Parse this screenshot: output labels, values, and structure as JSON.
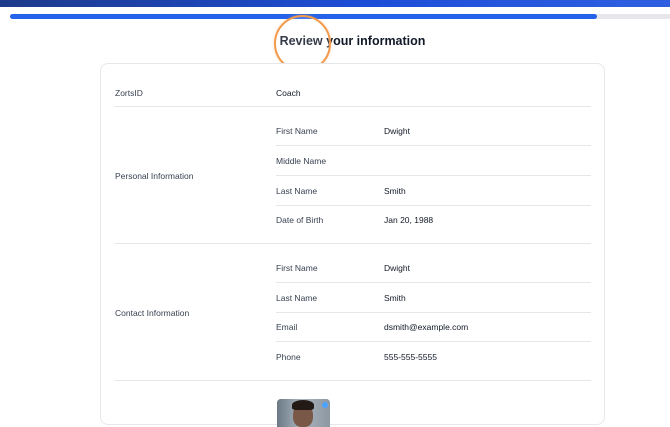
{
  "progress": {
    "fraction": 0.89
  },
  "title": "Review your information",
  "zortsid": {
    "label": "ZortsID",
    "value": "Coach"
  },
  "personal": {
    "label": "Personal Information",
    "fields": [
      {
        "label": "First Name",
        "value": "Dwight"
      },
      {
        "label": "Middle Name",
        "value": ""
      },
      {
        "label": "Last Name",
        "value": "Smith"
      },
      {
        "label": "Date of Birth",
        "value": "Jan 20, 1988"
      }
    ]
  },
  "contact": {
    "label": "Contact Information",
    "fields": [
      {
        "label": "First Name",
        "value": "Dwight"
      },
      {
        "label": "Last Name",
        "value": "Smith"
      },
      {
        "label": "Email",
        "value": "dsmith@example.com"
      },
      {
        "label": "Phone",
        "value": "555-555-5555"
      }
    ]
  },
  "colors": {
    "accent": "#2563eb",
    "highlight_ring": "#f2994a",
    "top_strip": "#1e3a8a"
  }
}
